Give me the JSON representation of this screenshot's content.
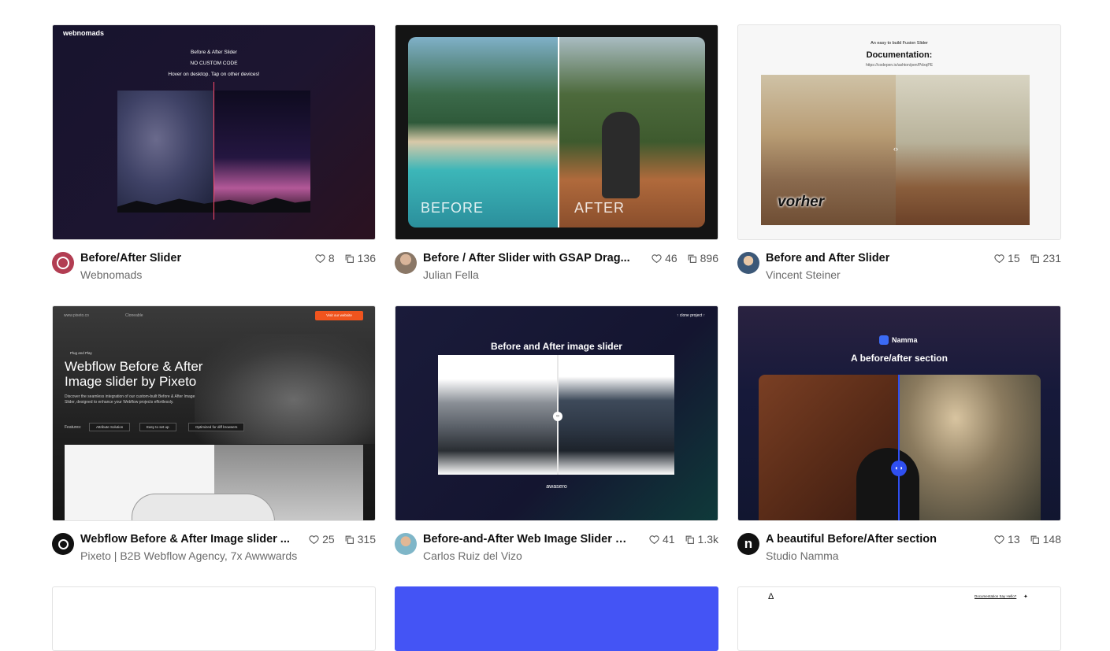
{
  "cards": [
    {
      "title": "Before/After Slider",
      "author": "Webnomads",
      "likes": "8",
      "clones": "136",
      "thumb": {
        "brand": "webnomads",
        "heading": "Before & After Slider",
        "sub1": "NO CUSTOM CODE",
        "sub2": "Hover on desktop. Tap on other devices!"
      }
    },
    {
      "title": "Before / After Slider with GSAP Drag...",
      "author": "Julian Fella",
      "likes": "46",
      "clones": "896",
      "thumb": {
        "before": "BEFORE",
        "after": "AFTER"
      }
    },
    {
      "title": "Before and After Slider",
      "author": "Vincent Steiner",
      "likes": "15",
      "clones": "231",
      "thumb": {
        "small": "An easy to build Fusion Slider",
        "heading": "Documentation:",
        "url": "https://codepen.io/ashton/pen/PdxqPE",
        "label": "vorher"
      }
    },
    {
      "title": "Webflow Before & After Image slider ...",
      "author": "Pixeto | B2B Webflow Agency, 7x Awwwards",
      "likes": "25",
      "clones": "315",
      "thumb": {
        "nav_left": "www.pixeto.co",
        "nav_mid": "Cloneable",
        "nav_cta": "Visit our website",
        "kicker": "Plug and Play",
        "heading1": "Webflow Before & After",
        "heading2": "Image slider by Pixeto",
        "desc": "Discover the seamless integration of our custom-built Before & After Image Slider, designed to enhance your Webflow projects effortlessly.",
        "features_label": "Features:",
        "f1": "Attribute Solution",
        "f2": "Easy to set up",
        "f3": "Optimized for diff browsers"
      }
    },
    {
      "title": "Before-and-After Web Image Slider W...",
      "author": "Carlos Ruiz del Vizo",
      "likes": "41",
      "clones": "1.3k",
      "thumb": {
        "clone": "↑ clone project ↑",
        "heading": "Before and After image slider",
        "brand": "awasero"
      }
    },
    {
      "title": "A beautiful Before/After section",
      "author": "Studio Namma",
      "likes": "13",
      "clones": "148",
      "thumb": {
        "brand": "Namma",
        "heading": "A before/after section"
      }
    }
  ],
  "row3": {
    "right_logo": "Δ",
    "right_links": "Documentation Say Hello?"
  },
  "colors": {
    "blue_card": "#4454f5",
    "title": "#111111",
    "muted": "#6b6b6b"
  },
  "icons": {
    "like": "heart-icon",
    "clone": "clone-icon"
  }
}
